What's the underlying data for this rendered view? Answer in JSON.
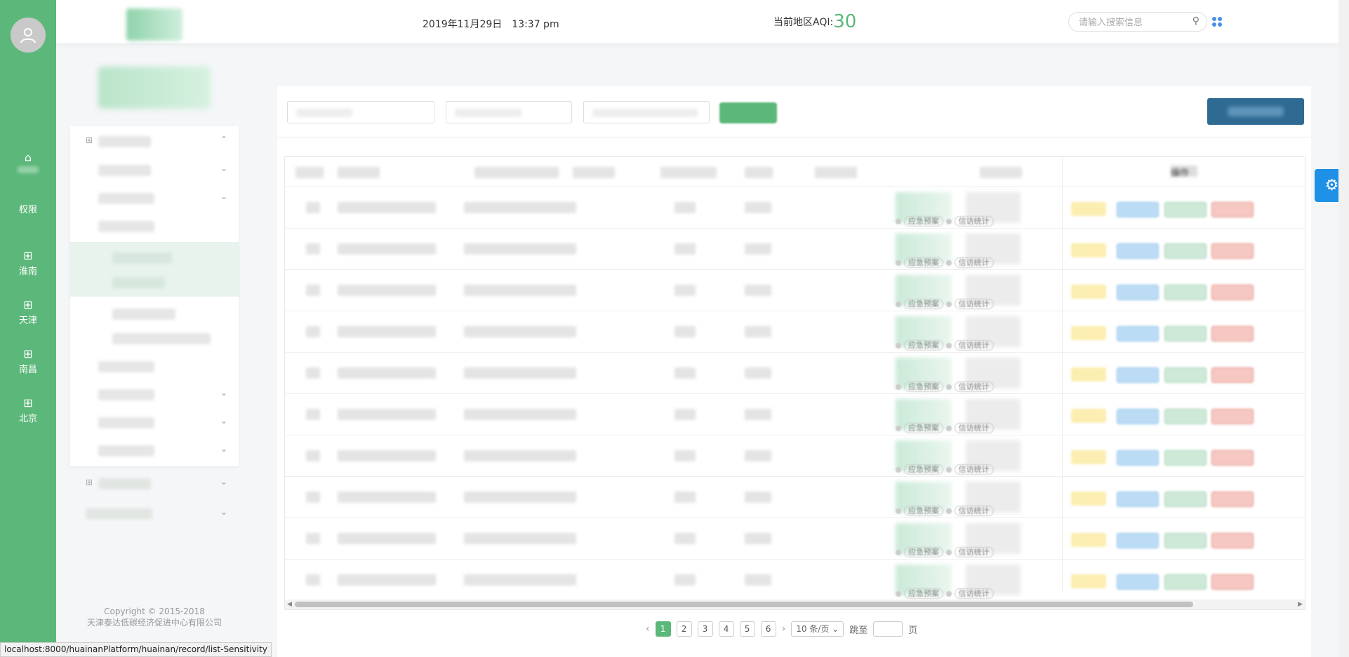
{
  "rail": {
    "items": [
      {
        "label": "",
        "icon": "home-icon"
      },
      {
        "label": "权限",
        "icon": "apple-icon"
      },
      {
        "label": "淮南",
        "icon": "grid-icon"
      },
      {
        "label": "天津",
        "icon": "grid-icon"
      },
      {
        "label": "南昌",
        "icon": "grid-icon"
      },
      {
        "label": "北京",
        "icon": "grid-icon"
      }
    ]
  },
  "header": {
    "date": "2019年11月29日　13:37 pm",
    "aqi_label": "当前地区AQI:",
    "aqi_value": "30",
    "search_placeholder": "请输入搜索信息"
  },
  "sidebar": {
    "copyright_line1": "Copyright © 2015-2018",
    "copyright_line2": "天津泰达低碳经济促进中心有限公司"
  },
  "table": {
    "header_op": "操作",
    "status_tags": [
      "应急预案",
      "信访统计"
    ]
  },
  "pagination": {
    "pages": [
      "1",
      "2",
      "3",
      "4",
      "5",
      "6"
    ],
    "current": "1",
    "page_size": "10 条/页",
    "jump_label": "跳至",
    "page_unit": "页"
  },
  "status_url": "localhost:8000/huainanPlatform/huainan/record/list-Sensitivity",
  "colors": {
    "brand_green": "#5cb87a",
    "primary_blue": "#2f6a93",
    "settings_blue": "#1e90e6"
  }
}
